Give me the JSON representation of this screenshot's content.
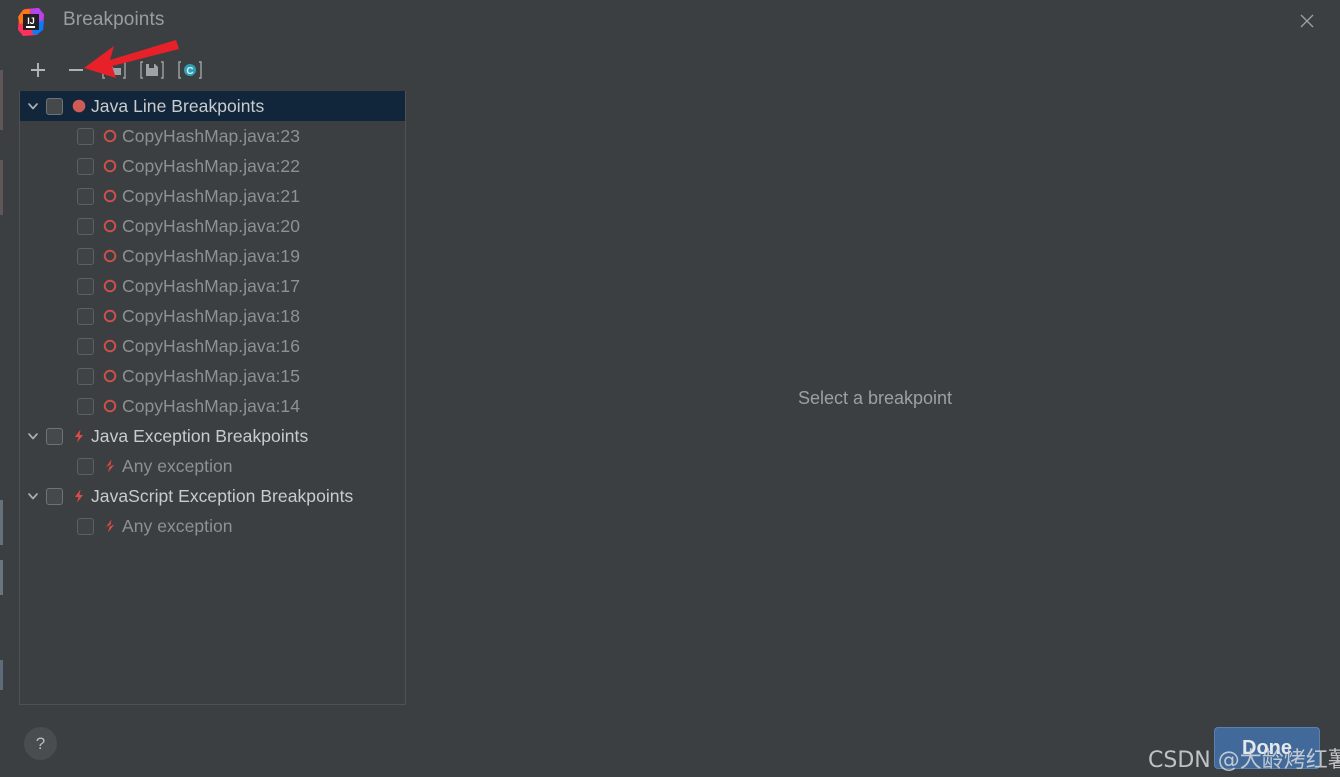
{
  "window": {
    "title": "Breakpoints",
    "app_icon": "intellij-idea-logo",
    "close_icon": "close-icon",
    "background_color": "#3c3f41"
  },
  "toolbar": {
    "buttons": [
      {
        "name": "add-breakpoint-button",
        "icon": "plus-icon",
        "label": "+"
      },
      {
        "name": "remove-breakpoint-button",
        "icon": "minus-icon",
        "label": "−"
      },
      {
        "name": "move-to-group-button",
        "icon": "folder-icon",
        "label": ""
      },
      {
        "name": "set-as-default-button",
        "icon": "save-disk-icon",
        "label": ""
      },
      {
        "name": "view-breakpoint-source-button",
        "icon": "circle-c-icon",
        "label": ""
      }
    ]
  },
  "annotation": {
    "type": "red-arrow",
    "color": "#e8202a",
    "points_to": "remove-breakpoint-button"
  },
  "tree": {
    "groups": [
      {
        "label": "Java Line Breakpoints",
        "icon": "breakpoint-dot-icon",
        "expanded": true,
        "checked": false,
        "selected": true,
        "children": [
          {
            "label": "CopyHashMap.java:23",
            "icon": "breakpoint-disabled-icon",
            "checked": false
          },
          {
            "label": "CopyHashMap.java:22",
            "icon": "breakpoint-disabled-icon",
            "checked": false
          },
          {
            "label": "CopyHashMap.java:21",
            "icon": "breakpoint-disabled-icon",
            "checked": false
          },
          {
            "label": "CopyHashMap.java:20",
            "icon": "breakpoint-disabled-icon",
            "checked": false
          },
          {
            "label": "CopyHashMap.java:19",
            "icon": "breakpoint-disabled-icon",
            "checked": false
          },
          {
            "label": "CopyHashMap.java:17",
            "icon": "breakpoint-disabled-icon",
            "checked": false
          },
          {
            "label": "CopyHashMap.java:18",
            "icon": "breakpoint-disabled-icon",
            "checked": false
          },
          {
            "label": "CopyHashMap.java:16",
            "icon": "breakpoint-disabled-icon",
            "checked": false
          },
          {
            "label": "CopyHashMap.java:15",
            "icon": "breakpoint-disabled-icon",
            "checked": false
          },
          {
            "label": "CopyHashMap.java:14",
            "icon": "breakpoint-disabled-icon",
            "checked": false
          }
        ]
      },
      {
        "label": "Java Exception Breakpoints",
        "icon": "exception-bolt-icon",
        "expanded": true,
        "checked": false,
        "selected": false,
        "children": [
          {
            "label": "Any exception",
            "icon": "exception-bolt-disabled-icon",
            "checked": false
          }
        ]
      },
      {
        "label": "JavaScript Exception Breakpoints",
        "icon": "exception-bolt-icon",
        "expanded": true,
        "checked": false,
        "selected": false,
        "children": [
          {
            "label": "Any exception",
            "icon": "exception-bolt-disabled-icon",
            "checked": false
          }
        ]
      }
    ]
  },
  "detail": {
    "empty_message": "Select a breakpoint"
  },
  "footer": {
    "help_label": "?",
    "help_icon": "question-mark-icon",
    "done_label": "Done",
    "done_color": "#41699a"
  },
  "watermark": {
    "text": "CSDN @大龄烤红薯"
  }
}
